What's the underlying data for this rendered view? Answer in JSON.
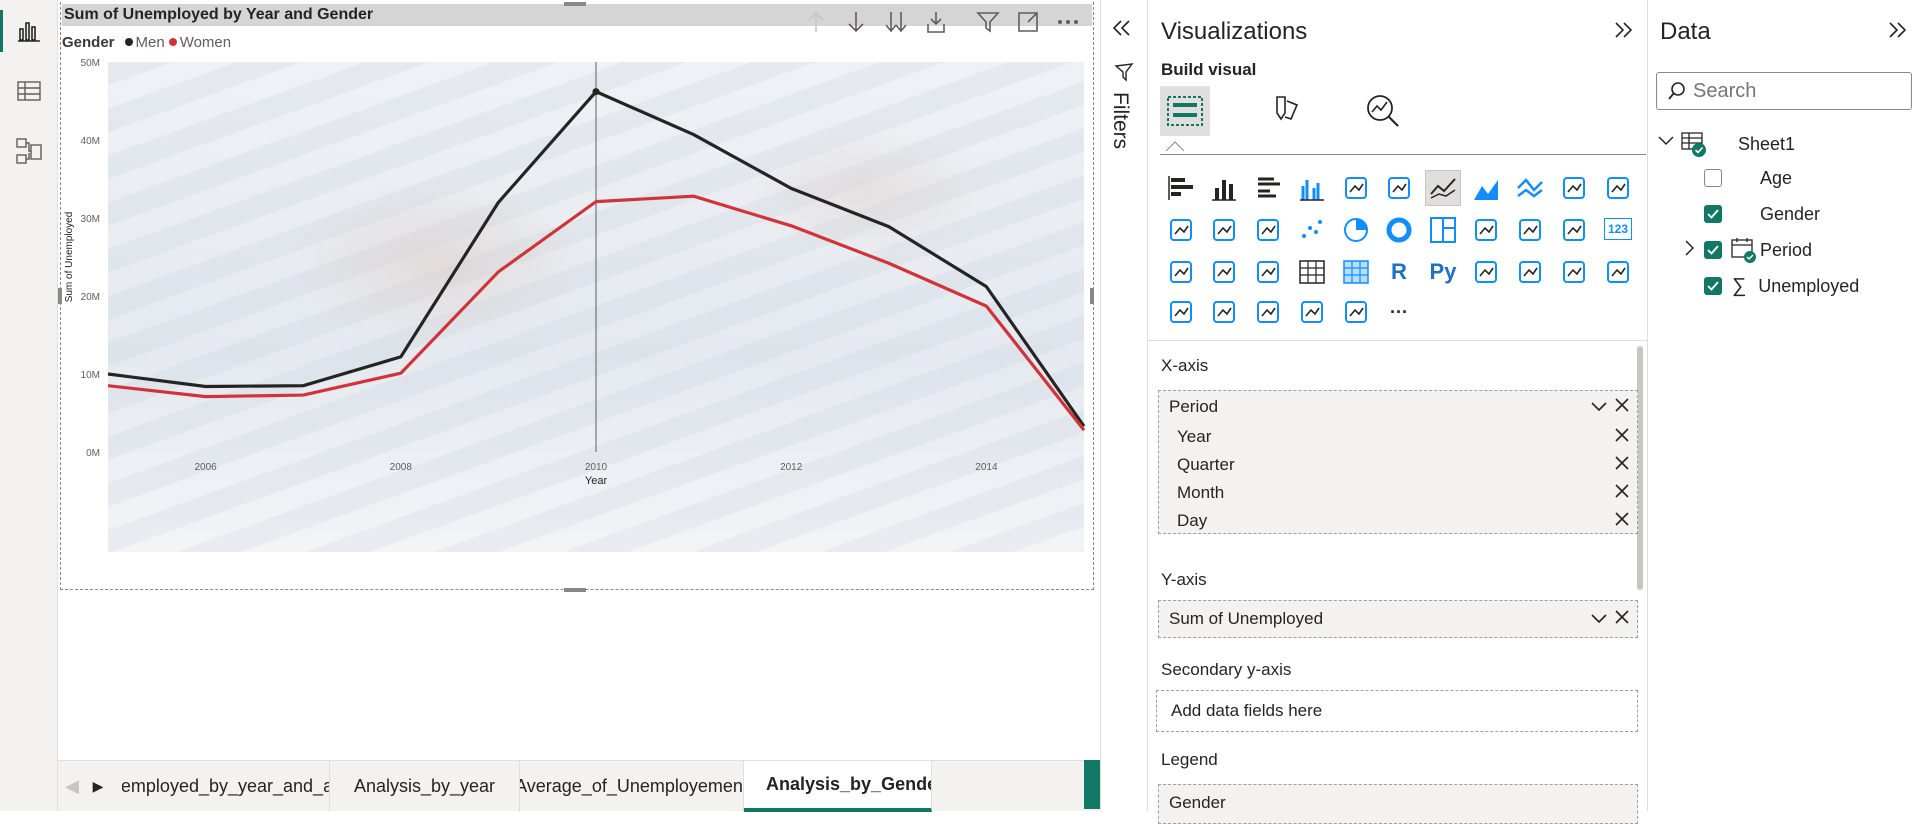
{
  "rail": {
    "icons": [
      "report-view-icon",
      "table-view-icon",
      "model-view-icon"
    ]
  },
  "visual": {
    "title": "Sum of Unemployed by Year and Gender",
    "legend_title": "Gender",
    "toolbar_icons": [
      "drill-up-icon",
      "drill-down-icon",
      "expand-next-level-icon",
      "expand-hierarchy-icon",
      "filter-icon",
      "focus-mode-icon",
      "more-options-icon"
    ]
  },
  "chart_data": {
    "type": "line",
    "title": "Sum of Unemployed by Year and Gender",
    "xlabel": "Year",
    "ylabel": "Sum of Unemployed",
    "x": [
      2005,
      2006,
      2007,
      2008,
      2009,
      2010,
      2011,
      2012,
      2013,
      2014,
      2015
    ],
    "xlim": [
      2005,
      2015
    ],
    "ylim": [
      0,
      50000000
    ],
    "x_ticks": [
      "2006",
      "2008",
      "2010",
      "2012",
      "2014"
    ],
    "y_ticks": [
      "0M",
      "10M",
      "20M",
      "30M",
      "40M",
      "50M"
    ],
    "y_tick_values": [
      0,
      10000000,
      20000000,
      30000000,
      40000000,
      50000000
    ],
    "x_tick_values": [
      2006,
      2008,
      2010,
      2012,
      2014
    ],
    "series": [
      {
        "name": "Men",
        "color": "#252423",
        "values": [
          10000000,
          8400000,
          8500000,
          12200000,
          32000000,
          46200000,
          40700000,
          33800000,
          28900000,
          21200000,
          3300000
        ]
      },
      {
        "name": "Women",
        "color": "#d13438",
        "values": [
          8500000,
          7100000,
          7300000,
          10100000,
          23100000,
          32100000,
          32800000,
          29000000,
          24200000,
          18700000,
          2800000
        ]
      }
    ],
    "legend": "top-left",
    "grid": false,
    "highlight_x": 2010
  },
  "tabs": [
    {
      "label": ""
    },
    {
      "label": ""
    },
    {
      "label": "Unemployed_by_year_and_age"
    },
    {
      "label": "Analysis_by_year"
    },
    {
      "label": "Average_of_Unemployement"
    },
    {
      "label": "Analysis_by_Gende"
    }
  ],
  "add_page_label": "+",
  "filters": {
    "label": "Filters"
  },
  "visualizations": {
    "title": "Visualizations",
    "build_visual": "Build visual",
    "icons": [
      "stacked-bar-icon",
      "stacked-column-icon",
      "clustered-bar-icon",
      "clustered-column-icon",
      "100pct-bar-icon",
      "100pct-column-icon",
      "line-chart-icon",
      "area-chart-icon",
      "stacked-area-icon",
      "line-clustered-column-icon",
      "line-stacked-column-icon",
      "ribbon-chart-icon",
      "waterfall-icon",
      "funnel-icon",
      "scatter-icon",
      "pie-icon",
      "donut-icon",
      "treemap-icon",
      "map-icon",
      "filled-map-icon",
      "gauge-icon",
      "card-icon",
      "multirow-card-icon",
      "kpi-icon",
      "slicer-icon",
      "table-icon",
      "matrix-icon",
      "r-visual-icon",
      "python-visual-icon",
      "key-influencers-icon",
      "decomposition-tree-icon",
      "qa-icon",
      "narrative-icon",
      "metrics-icon",
      "paginated-report-icon",
      "power-apps-icon",
      "power-automate-icon",
      "arcgis-icon",
      "more-visuals-icon"
    ],
    "r_label": "R",
    "py_label": "Py",
    "card_label": "123",
    "more_label": "···",
    "xaxis_label": "X-axis",
    "xaxis_field": "Period",
    "xaxis_items": [
      "Year",
      "Quarter",
      "Month",
      "Day"
    ],
    "yaxis_label": "Y-axis",
    "yaxis_field": "Sum of Unemployed",
    "secondary_label": "Secondary y-axis",
    "secondary_placeholder": "Add data fields here",
    "legend_label": "Legend",
    "legend_field": "Gender"
  },
  "data_pane": {
    "title": "Data",
    "search_placeholder": "Search",
    "table": "Sheet1",
    "fields": [
      {
        "name": "Age",
        "checked": false
      },
      {
        "name": "Gender",
        "checked": true
      },
      {
        "name": "Period",
        "checked": true
      },
      {
        "name": "Unemployed",
        "checked": true
      }
    ]
  },
  "colors": {
    "accent": "#117865",
    "men": "#252423",
    "women": "#d13438",
    "viz_icon": "#118dff"
  }
}
